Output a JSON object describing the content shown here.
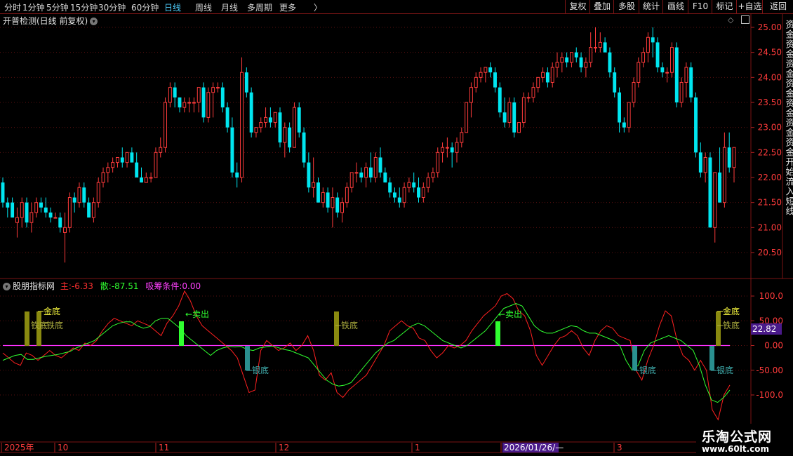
{
  "toolbar": {
    "periods": [
      "分时",
      "1分钟",
      "5分钟",
      "15分钟",
      "30分钟",
      "60分钟",
      "日线",
      "周线",
      "月线",
      "多周期",
      "更多"
    ],
    "active_period": "日线",
    "more_arrow": "〉",
    "right_buttons": [
      "复权",
      "叠加",
      "多股",
      "统计",
      "画线",
      "F10",
      "标记",
      "+自选",
      "返回"
    ]
  },
  "main_panel": {
    "title": "开普检测(日线 前复权)",
    "y_ticks": [
      "25.00",
      "24.50",
      "24.00",
      "23.50",
      "23.00",
      "22.50",
      "22.00",
      "21.50",
      "21.00",
      "20.50"
    ],
    "side_text": "资金资金资金资金资金资金资金开始流入短线",
    "colors": {
      "up": "#ff3b3b",
      "down": "#00e6f0",
      "grid": "#5a1010"
    }
  },
  "indicator_panel": {
    "name": "股朋指标网",
    "main_label": "主:",
    "main_value": "-6.33",
    "scatter_label": "散:",
    "scatter_value": "-87.51",
    "absorb_label": "吸筹条件:",
    "absorb_value": "0.00",
    "y_ticks": [
      "100.0",
      "50.00",
      "0.00",
      "-50.00",
      "-100.0"
    ],
    "current_value": "22.82",
    "signals": {
      "gold": "金底",
      "iron": "铁底",
      "silver": "银底",
      "sell": "卖出",
      "sell_arrow": "←卖出"
    },
    "colors": {
      "main": "#ff2020",
      "scatter": "#30ff30",
      "zero": "#ff30ff",
      "gold": "#ffff40",
      "iron": "#8a8a10"
    }
  },
  "time_axis": {
    "labels": [
      "2025年",
      "10",
      "11",
      "12",
      "1",
      "2026/01/26/—",
      "3"
    ]
  },
  "watermark": {
    "title": "乐淘公式网",
    "url": "www.60lt.com"
  },
  "chart_data": [
    {
      "type": "candlestick",
      "title": "开普检测(日线 前复权)",
      "ylim": [
        20.2,
        25.1
      ],
      "ohlc_note": "open, high, low, close per day",
      "candles": [
        [
          21.9,
          22.0,
          21.4,
          21.5
        ],
        [
          21.5,
          21.6,
          21.2,
          21.4
        ],
        [
          21.5,
          21.6,
          21.2,
          21.2
        ],
        [
          21.1,
          21.4,
          20.8,
          21.2
        ],
        [
          21.2,
          21.6,
          21.0,
          21.5
        ],
        [
          21.5,
          21.6,
          21.0,
          21.1
        ],
        [
          21.1,
          21.5,
          20.9,
          21.3
        ],
        [
          21.3,
          21.6,
          21.2,
          21.5
        ],
        [
          21.5,
          21.6,
          21.3,
          21.4
        ],
        [
          21.4,
          21.6,
          21.2,
          21.3
        ],
        [
          21.3,
          21.4,
          21.1,
          21.2
        ],
        [
          21.2,
          21.3,
          21.2,
          21.2
        ],
        [
          21.2,
          21.3,
          20.9,
          21.0
        ],
        [
          20.9,
          21.3,
          20.3,
          21.0
        ],
        [
          21.0,
          21.7,
          20.9,
          21.6
        ],
        [
          21.6,
          21.7,
          21.3,
          21.5
        ],
        [
          21.5,
          21.9,
          21.4,
          21.8
        ],
        [
          21.8,
          21.9,
          21.4,
          21.5
        ],
        [
          21.5,
          21.6,
          21.2,
          21.2
        ],
        [
          21.2,
          21.6,
          21.1,
          21.5
        ],
        [
          21.5,
          22.0,
          21.4,
          21.9
        ],
        [
          21.9,
          22.2,
          21.8,
          22.1
        ],
        [
          22.1,
          22.3,
          21.9,
          22.2
        ],
        [
          22.2,
          22.4,
          22.1,
          22.3
        ],
        [
          22.3,
          22.4,
          22.2,
          22.4
        ],
        [
          22.4,
          22.6,
          22.2,
          22.3
        ],
        [
          22.3,
          22.5,
          22.2,
          22.5
        ],
        [
          22.5,
          22.6,
          22.3,
          22.3
        ],
        [
          22.3,
          22.5,
          22.0,
          22.0
        ],
        [
          22.0,
          22.2,
          21.9,
          21.9
        ],
        [
          21.9,
          22.1,
          21.9,
          22.0
        ],
        [
          22.0,
          22.1,
          21.9,
          22.0
        ],
        [
          22.0,
          22.6,
          22.0,
          22.5
        ],
        [
          22.5,
          22.8,
          22.4,
          22.6
        ],
        [
          22.6,
          23.6,
          22.5,
          23.5
        ],
        [
          23.5,
          23.9,
          23.4,
          23.8
        ],
        [
          23.8,
          23.9,
          23.4,
          23.6
        ],
        [
          23.6,
          23.6,
          23.3,
          23.4
        ],
        [
          23.4,
          23.6,
          23.3,
          23.5
        ],
        [
          23.5,
          23.6,
          23.3,
          23.5
        ],
        [
          23.5,
          23.6,
          23.3,
          23.5
        ],
        [
          23.5,
          23.8,
          23.3,
          23.8
        ],
        [
          23.8,
          23.9,
          23.1,
          23.2
        ],
        [
          23.2,
          23.8,
          23.1,
          23.7
        ],
        [
          23.7,
          23.9,
          23.2,
          23.8
        ],
        [
          23.8,
          23.9,
          23.7,
          23.8
        ],
        [
          23.8,
          23.9,
          23.3,
          23.4
        ],
        [
          23.4,
          23.5,
          22.9,
          23.0
        ],
        [
          23.0,
          23.2,
          22.0,
          22.1
        ],
        [
          22.1,
          22.3,
          21.8,
          22.0
        ],
        [
          22.0,
          24.4,
          21.9,
          24.1
        ],
        [
          24.1,
          24.2,
          23.6,
          23.7
        ],
        [
          23.7,
          23.8,
          22.8,
          22.9
        ],
        [
          22.9,
          23.0,
          22.8,
          23.0
        ],
        [
          23.0,
          23.2,
          22.9,
          23.1
        ],
        [
          23.1,
          23.4,
          23.0,
          23.2
        ],
        [
          23.2,
          23.4,
          23.0,
          23.1
        ],
        [
          23.1,
          23.3,
          23.0,
          23.3
        ],
        [
          23.3,
          23.4,
          22.6,
          22.7
        ],
        [
          22.7,
          23.1,
          22.4,
          23.0
        ],
        [
          23.0,
          23.1,
          22.5,
          22.6
        ],
        [
          22.6,
          23.5,
          22.6,
          23.4
        ],
        [
          23.4,
          23.5,
          22.8,
          22.9
        ],
        [
          22.9,
          23.0,
          22.2,
          22.3
        ],
        [
          22.3,
          22.5,
          21.7,
          21.8
        ],
        [
          21.8,
          22.4,
          21.6,
          21.9
        ],
        [
          21.9,
          22.0,
          21.5,
          21.5
        ],
        [
          21.5,
          21.8,
          21.4,
          21.7
        ],
        [
          21.7,
          21.8,
          21.3,
          21.4
        ],
        [
          21.4,
          21.8,
          21.0,
          21.6
        ],
        [
          21.6,
          21.7,
          21.2,
          21.3
        ],
        [
          21.3,
          21.6,
          21.1,
          21.5
        ],
        [
          21.5,
          21.9,
          21.4,
          21.8
        ],
        [
          21.8,
          22.1,
          21.7,
          22.1
        ],
        [
          22.1,
          22.3,
          21.9,
          22.1
        ],
        [
          22.1,
          22.2,
          21.9,
          22.0
        ],
        [
          22.0,
          22.3,
          21.8,
          22.2
        ],
        [
          22.2,
          22.5,
          21.9,
          22.0
        ],
        [
          22.0,
          22.5,
          21.9,
          22.4
        ],
        [
          22.4,
          22.6,
          22.0,
          22.1
        ],
        [
          22.1,
          22.2,
          21.9,
          21.9
        ],
        [
          21.9,
          22.0,
          21.6,
          21.7
        ],
        [
          21.7,
          21.8,
          21.5,
          21.6
        ],
        [
          21.6,
          21.8,
          21.4,
          21.5
        ],
        [
          21.5,
          21.9,
          21.4,
          21.8
        ],
        [
          21.8,
          22.0,
          21.7,
          21.9
        ],
        [
          21.9,
          22.1,
          21.7,
          21.8
        ],
        [
          21.8,
          22.0,
          21.5,
          21.6
        ],
        [
          21.6,
          21.9,
          21.5,
          21.8
        ],
        [
          21.8,
          22.1,
          21.7,
          22.0
        ],
        [
          22.0,
          22.2,
          21.9,
          22.1
        ],
        [
          22.1,
          22.6,
          22.0,
          22.5
        ],
        [
          22.5,
          22.7,
          22.3,
          22.6
        ],
        [
          22.6,
          22.8,
          22.4,
          22.6
        ],
        [
          22.6,
          22.7,
          22.2,
          22.5
        ],
        [
          22.5,
          22.8,
          22.3,
          22.7
        ],
        [
          22.7,
          23.0,
          22.6,
          22.9
        ],
        [
          22.9,
          23.5,
          22.9,
          23.5
        ],
        [
          23.5,
          23.9,
          23.2,
          23.8
        ],
        [
          23.8,
          24.1,
          23.7,
          24.0
        ],
        [
          24.0,
          24.2,
          23.9,
          24.1
        ],
        [
          24.1,
          24.2,
          23.9,
          24.2
        ],
        [
          24.2,
          24.3,
          24.0,
          24.1
        ],
        [
          24.1,
          24.2,
          23.7,
          23.8
        ],
        [
          23.8,
          23.9,
          23.2,
          23.3
        ],
        [
          23.3,
          23.6,
          23.0,
          23.1
        ],
        [
          23.1,
          23.6,
          23.0,
          23.5
        ],
        [
          23.5,
          23.6,
          22.8,
          22.9
        ],
        [
          22.9,
          23.1,
          22.9,
          23.1
        ],
        [
          23.1,
          23.7,
          23.0,
          23.6
        ],
        [
          23.6,
          23.7,
          23.5,
          23.6
        ],
        [
          23.6,
          23.9,
          23.5,
          23.8
        ],
        [
          23.8,
          24.0,
          23.7,
          24.0
        ],
        [
          24.0,
          24.2,
          23.9,
          24.1
        ],
        [
          24.1,
          24.2,
          23.8,
          23.9
        ],
        [
          23.9,
          24.3,
          23.8,
          24.2
        ],
        [
          24.2,
          24.5,
          24.0,
          24.3
        ],
        [
          24.3,
          24.5,
          24.1,
          24.4
        ],
        [
          24.4,
          24.5,
          24.2,
          24.3
        ],
        [
          24.3,
          24.5,
          24.2,
          24.5
        ],
        [
          24.5,
          24.6,
          24.3,
          24.4
        ],
        [
          24.4,
          24.5,
          24.1,
          24.2
        ],
        [
          24.2,
          24.4,
          24.0,
          24.3
        ],
        [
          24.3,
          24.9,
          24.2,
          24.6
        ],
        [
          24.6,
          25.0,
          24.5,
          24.6
        ],
        [
          24.6,
          24.9,
          24.5,
          24.7
        ],
        [
          24.7,
          24.8,
          24.5,
          24.5
        ],
        [
          24.5,
          24.6,
          24.0,
          24.1
        ],
        [
          24.1,
          24.2,
          23.6,
          23.7
        ],
        [
          23.7,
          23.8,
          22.9,
          23.1
        ],
        [
          23.1,
          23.2,
          22.9,
          23.0
        ],
        [
          23.0,
          23.5,
          22.9,
          23.5
        ],
        [
          23.5,
          24.0,
          23.4,
          23.9
        ],
        [
          23.9,
          24.4,
          23.8,
          24.3
        ],
        [
          24.3,
          24.6,
          24.2,
          24.5
        ],
        [
          24.5,
          24.9,
          24.3,
          24.8
        ],
        [
          24.8,
          25.0,
          24.4,
          24.7
        ],
        [
          24.7,
          24.8,
          24.1,
          24.2
        ],
        [
          24.2,
          24.3,
          24.0,
          24.1
        ],
        [
          24.1,
          24.2,
          23.9,
          24.1
        ],
        [
          24.1,
          24.7,
          24.0,
          24.6
        ],
        [
          24.6,
          24.7,
          23.4,
          23.5
        ],
        [
          23.5,
          24.0,
          23.4,
          23.9
        ],
        [
          23.9,
          24.3,
          23.6,
          24.2
        ],
        [
          24.2,
          24.3,
          23.5,
          23.6
        ],
        [
          23.6,
          23.7,
          22.4,
          22.5
        ],
        [
          22.5,
          22.7,
          22.0,
          22.1
        ],
        [
          22.1,
          22.5,
          21.9,
          22.4
        ],
        [
          22.4,
          22.5,
          21.2,
          21.0
        ],
        [
          21.0,
          22.1,
          20.7,
          22.1
        ],
        [
          22.1,
          22.6,
          21.5,
          21.5
        ],
        [
          21.5,
          22.9,
          21.4,
          22.6
        ],
        [
          22.6,
          22.9,
          22.1,
          22.2
        ],
        [
          22.2,
          22.6,
          21.9,
          22.6
        ]
      ]
    },
    {
      "type": "line",
      "title": "股朋指标网",
      "ylim": [
        -150,
        115
      ],
      "series": [
        {
          "name": "主",
          "values": [
            -15,
            -25,
            -35,
            -40,
            -15,
            -20,
            -30,
            -20,
            -10,
            -20,
            -25,
            -15,
            -5,
            -10,
            5,
            0,
            10,
            30,
            45,
            55,
            50,
            45,
            40,
            50,
            45,
            40,
            30,
            20,
            45,
            60,
            80,
            110,
            90,
            60,
            40,
            30,
            20,
            10,
            0,
            -10,
            -25,
            -60,
            -95,
            -90,
            -10,
            10,
            0,
            -10,
            -5,
            5,
            -10,
            0,
            20,
            -10,
            -60,
            -70,
            -55,
            -95,
            -105,
            -90,
            -80,
            -70,
            -60,
            -40,
            -20,
            0,
            30,
            40,
            50,
            40,
            35,
            15,
            10,
            -10,
            -25,
            -15,
            0,
            -5,
            0,
            10,
            30,
            45,
            60,
            70,
            80,
            100,
            105,
            95,
            70,
            60,
            30,
            -20,
            -40,
            -20,
            0,
            15,
            20,
            30,
            20,
            -5,
            -20,
            10,
            30,
            40,
            35,
            20,
            15,
            10,
            -50,
            -70,
            -30,
            0,
            40,
            70,
            60,
            10,
            -20,
            -30,
            -50,
            -30,
            -50,
            -130,
            -150,
            -100,
            -80
          ]
        },
        {
          "name": "散",
          "values": [
            -30,
            -25,
            -20,
            -18,
            -28,
            -28,
            -25,
            -22,
            -20,
            -18,
            -15,
            -12,
            -5,
            0,
            5,
            10,
            20,
            30,
            40,
            45,
            48,
            48,
            40,
            35,
            38,
            50,
            55,
            55,
            45,
            35,
            20,
            10,
            0,
            -10,
            -20,
            -10,
            -5,
            -2,
            -3,
            -2,
            -8,
            -10,
            -5,
            -3,
            -1,
            -4,
            -8,
            -10,
            -15,
            -20,
            -25,
            -40,
            -55,
            -70,
            -78,
            -82,
            -80,
            -75,
            -60,
            -45,
            -30,
            -15,
            -5,
            5,
            10,
            20,
            30,
            40,
            45,
            40,
            30,
            20,
            10,
            5,
            0,
            -5,
            0,
            10,
            20,
            30,
            45,
            60,
            75,
            80,
            85,
            80,
            60,
            40,
            30,
            25,
            25,
            30,
            35,
            40,
            38,
            30,
            25,
            25,
            20,
            15,
            10,
            0,
            -30,
            -50,
            -40,
            -10,
            5,
            10,
            15,
            20,
            15,
            10,
            0,
            -10,
            -40,
            -80,
            -110,
            -115,
            -105,
            -90
          ]
        }
      ]
    }
  ]
}
